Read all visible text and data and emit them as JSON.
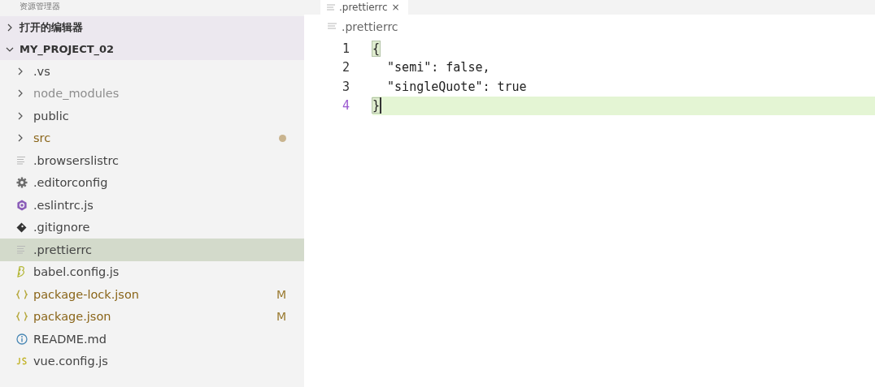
{
  "explorer": {
    "title": "资源管理器",
    "sections": [
      {
        "label": "打开的编辑器",
        "expanded": false
      },
      {
        "label": "MY_PROJECT_02",
        "expanded": true,
        "items": [
          {
            "name": ".vs",
            "kind": "folder",
            "expanded": false,
            "dimmed": false,
            "modified": false,
            "selected": false
          },
          {
            "name": "node_modules",
            "kind": "folder",
            "expanded": false,
            "dimmed": true,
            "modified": false,
            "selected": false
          },
          {
            "name": "public",
            "kind": "folder",
            "expanded": false,
            "dimmed": false,
            "modified": false,
            "selected": false
          },
          {
            "name": "src",
            "kind": "folder",
            "expanded": false,
            "dimmed": false,
            "modified": true,
            "dot": true,
            "selected": false
          },
          {
            "name": ".browserslistrc",
            "kind": "text",
            "dimmed": false,
            "modified": false,
            "selected": false
          },
          {
            "name": ".editorconfig",
            "kind": "config",
            "dimmed": false,
            "modified": false,
            "selected": false
          },
          {
            "name": ".eslintrc.js",
            "kind": "eslint",
            "dimmed": false,
            "modified": false,
            "selected": false
          },
          {
            "name": ".gitignore",
            "kind": "git",
            "dimmed": false,
            "modified": false,
            "selected": false
          },
          {
            "name": ".prettierrc",
            "kind": "text",
            "dimmed": false,
            "modified": false,
            "selected": true
          },
          {
            "name": "babel.config.js",
            "kind": "babel",
            "dimmed": false,
            "modified": false,
            "selected": false
          },
          {
            "name": "package-lock.json",
            "kind": "json",
            "dimmed": false,
            "modified": true,
            "badge": "M",
            "selected": false
          },
          {
            "name": "package.json",
            "kind": "json",
            "dimmed": false,
            "modified": true,
            "badge": "M",
            "selected": false
          },
          {
            "name": "README.md",
            "kind": "readme",
            "dimmed": false,
            "modified": false,
            "selected": false
          },
          {
            "name": "vue.config.js",
            "kind": "js",
            "dimmed": false,
            "modified": false,
            "selected": false
          }
        ]
      }
    ]
  },
  "editor": {
    "tab": {
      "label": ".prettierrc",
      "close": "×"
    },
    "breadcrumb": ".prettierrc",
    "lines": [
      {
        "number": "1",
        "text": "{",
        "current": false,
        "bracket_match": true
      },
      {
        "number": "2",
        "text": "  \"semi\": false,",
        "current": false,
        "bracket_match": false
      },
      {
        "number": "3",
        "text": "  \"singleQuote\": true",
        "current": false,
        "bracket_match": false
      },
      {
        "number": "4",
        "text": "}",
        "current": true,
        "bracket_match": true
      }
    ]
  }
}
